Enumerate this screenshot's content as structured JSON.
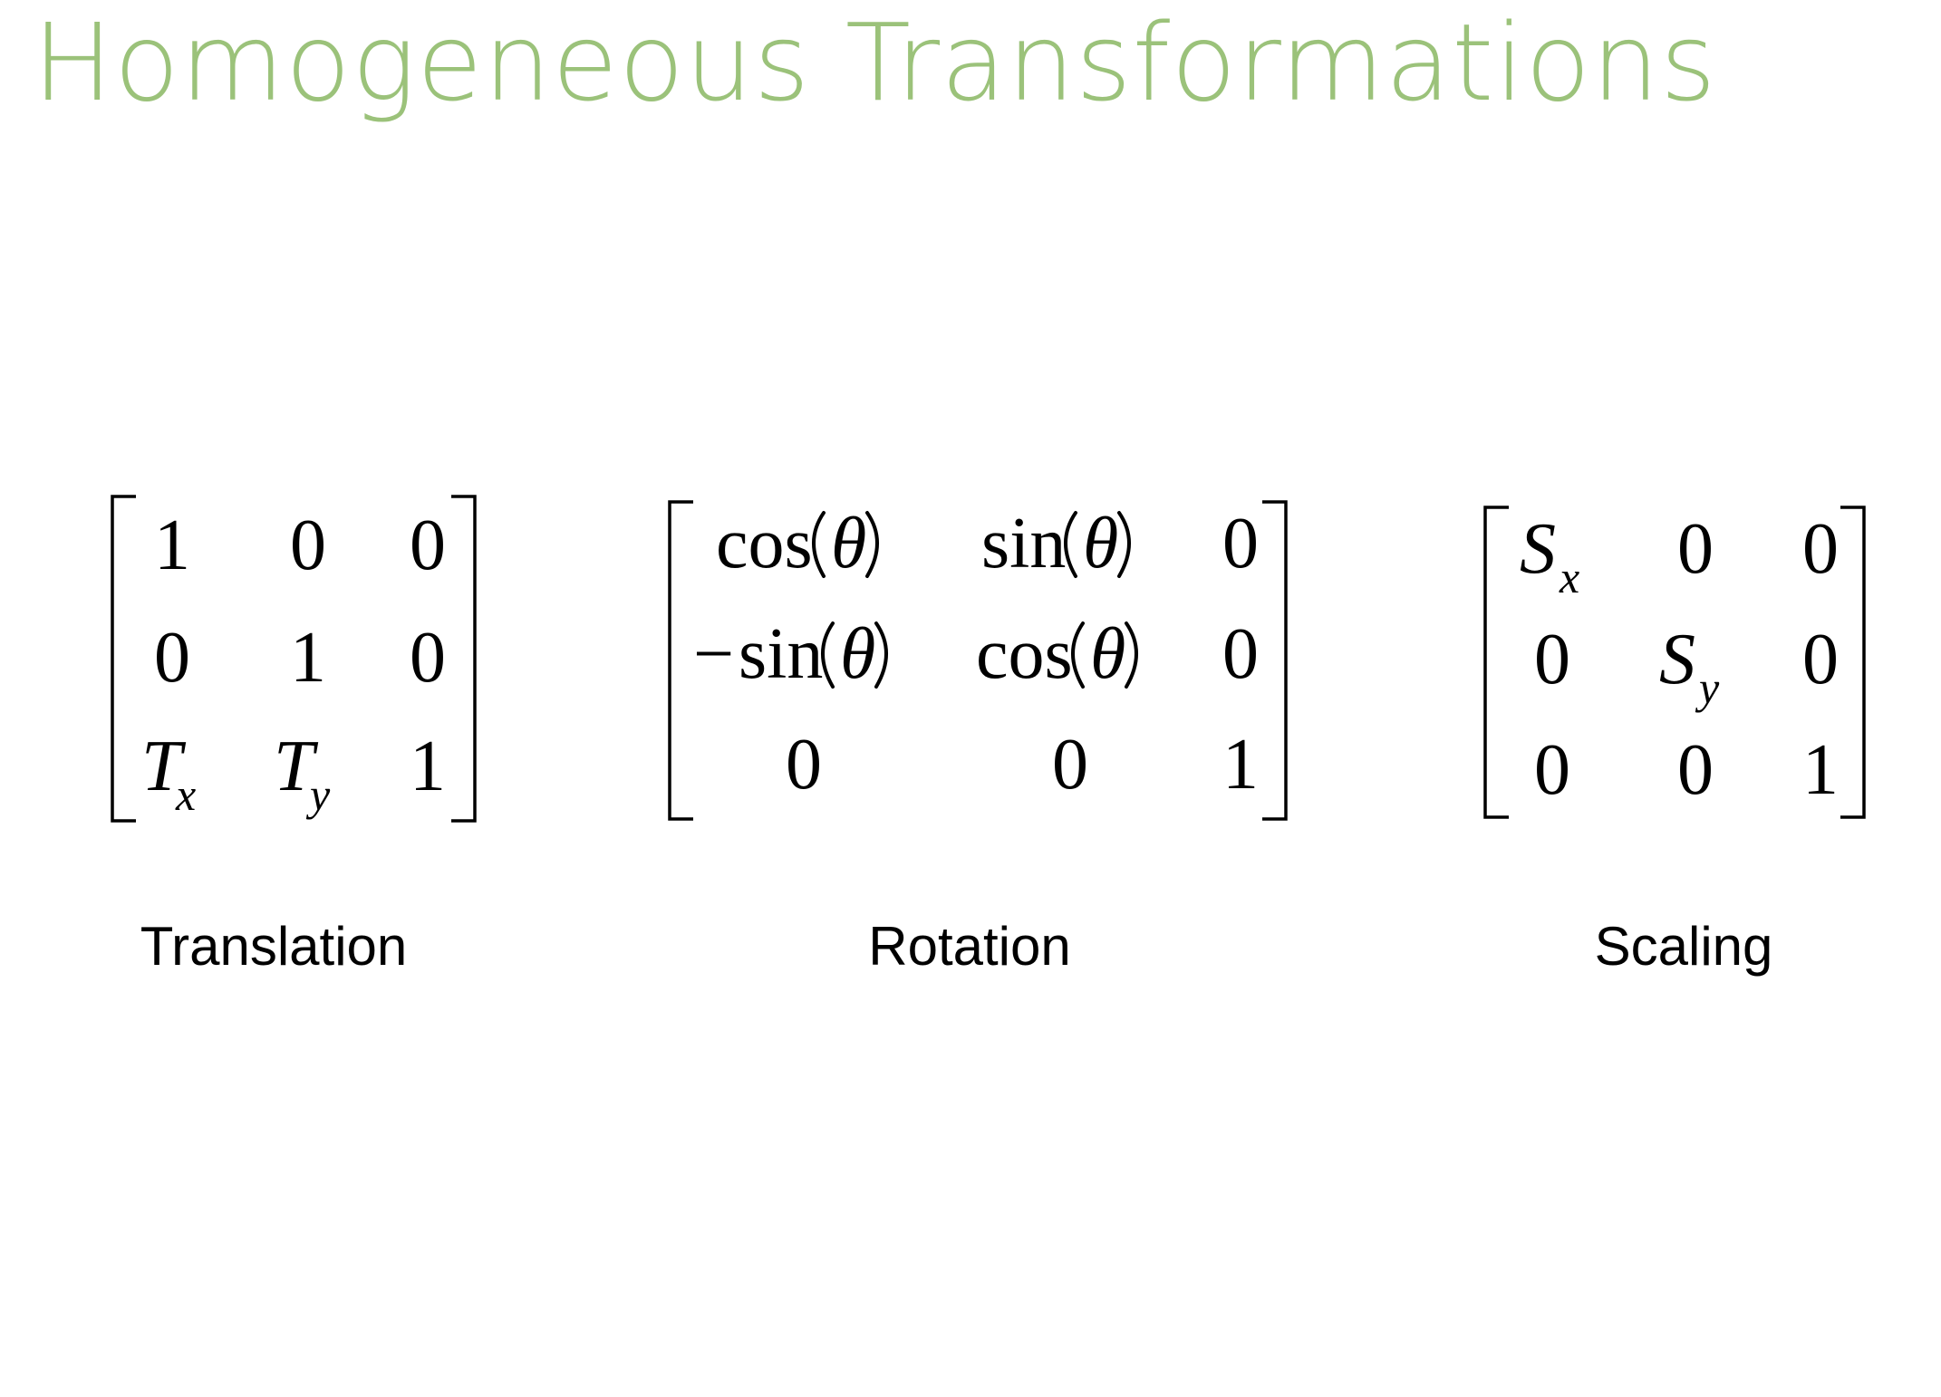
{
  "slide": {
    "title": "Homogeneous Transformations",
    "title_color": "#9bc27a"
  },
  "matrices": {
    "translation": {
      "label": "Translation",
      "r0c0": "1",
      "r0c1": "0",
      "r0c2": "0",
      "r1c0": "0",
      "r1c1": "1",
      "r1c2": "0",
      "r2c0_main": "T",
      "r2c0_sub": "x",
      "r2c1_main": "T",
      "r2c1_sub": "y",
      "r2c2": "1"
    },
    "rotation": {
      "label": "Rotation",
      "r0c0_fn": "cos",
      "r0c0_arg": "θ",
      "r0c1_fn": "sin",
      "r0c1_arg": "θ",
      "r0c2": "0",
      "r1c0_sign": "−",
      "r1c0_fn": "sin",
      "r1c0_arg": "θ",
      "r1c1_fn": "cos",
      "r1c1_arg": "θ",
      "r1c2": "0",
      "r2c0": "0",
      "r2c1": "0",
      "r2c2": "1"
    },
    "scaling": {
      "label": "Scaling",
      "r0c0_main": "S",
      "r0c0_sub": "x",
      "r0c1": "0",
      "r0c2": "0",
      "r1c0": "0",
      "r1c1_main": "S",
      "r1c1_sub": "y",
      "r1c2": "0",
      "r2c0": "0",
      "r2c1": "0",
      "r2c2": "1"
    }
  }
}
